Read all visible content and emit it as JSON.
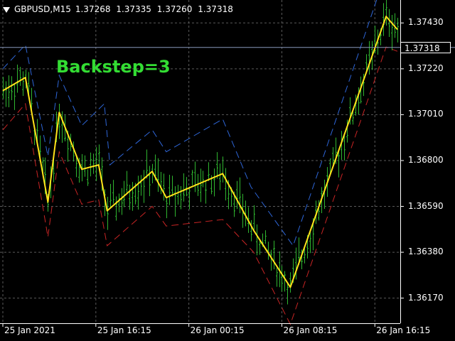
{
  "header": {
    "symbol": "GBPUSD,M15",
    "open": "1.37268",
    "high": "1.37335",
    "low": "1.37260",
    "close": "1.37318"
  },
  "overlay_label": "Backstep=3",
  "current_price": "1.37318",
  "colors": {
    "background": "#000000",
    "candles": "#2fb52f",
    "zigzag": "#ffe21a",
    "upper_band": "#2e66d8",
    "lower_band": "#c82424",
    "overlay_label": "#33dd33",
    "grid": "#5a5a5a",
    "price_line": "#8899bb"
  },
  "chart_data": {
    "type": "line",
    "title": "",
    "xlabel": "",
    "ylabel": "",
    "ylim": [
      1.36055,
      1.37535
    ],
    "x_tick_labels": [
      "25 Jan 2021",
      "25 Jan 16:15",
      "26 Jan 00:15",
      "26 Jan 08:15",
      "26 Jan 16:15"
    ],
    "y_tick_labels": [
      "1.37430",
      "1.37220",
      "1.37010",
      "1.36800",
      "1.36590",
      "1.36380",
      "1.36170"
    ],
    "y_ticks": [
      1.3743,
      1.3722,
      1.3701,
      1.368,
      1.3659,
      1.3638,
      1.3617
    ],
    "current_price": 1.37318,
    "bar_count": 140,
    "series": [
      {
        "points": [
          [
            0,
            1.3712
          ],
          [
            8,
            1.3718
          ],
          [
            16,
            1.3661
          ],
          [
            20,
            1.3702
          ],
          [
            28,
            1.3676
          ],
          [
            34,
            1.3678
          ],
          [
            37,
            1.3657
          ],
          [
            53,
            1.3675
          ],
          [
            58,
            1.3663
          ],
          [
            78,
            1.3674
          ],
          [
            89,
            1.3648
          ],
          [
            102,
            1.3622
          ],
          [
            136,
            1.3746
          ],
          [
            140,
            1.374
          ]
        ]
      },
      {
        "points": [
          [
            0,
            1.3722
          ],
          [
            8,
            1.3733
          ],
          [
            16,
            1.3682
          ],
          [
            20,
            1.3719
          ],
          [
            28,
            1.3696
          ],
          [
            36,
            1.3706
          ],
          [
            38,
            1.3678
          ],
          [
            53,
            1.3694
          ],
          [
            58,
            1.3684
          ],
          [
            78,
            1.3699
          ],
          [
            88,
            1.3668
          ],
          [
            103,
            1.3641
          ],
          [
            133,
            1.3755
          ],
          [
            136,
            1.3763
          ],
          [
            140,
            1.376
          ]
        ]
      },
      {
        "points": [
          [
            0,
            1.3694
          ],
          [
            8,
            1.3706
          ],
          [
            16,
            1.3645
          ],
          [
            20,
            1.3684
          ],
          [
            28,
            1.366
          ],
          [
            34,
            1.3662
          ],
          [
            37,
            1.3641
          ],
          [
            53,
            1.3659
          ],
          [
            58,
            1.365
          ],
          [
            78,
            1.3653
          ],
          [
            89,
            1.3638
          ],
          [
            102,
            1.3605
          ],
          [
            136,
            1.3732
          ],
          [
            140,
            1.373
          ]
        ]
      }
    ]
  }
}
